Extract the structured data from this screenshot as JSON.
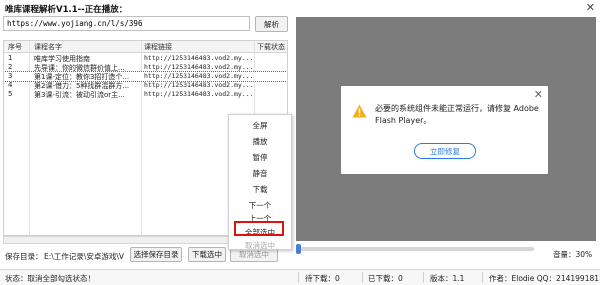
{
  "window": {
    "title": "唯库课程解析V1.1--正在播放：",
    "close_glyph": "✕"
  },
  "url_bar": {
    "value": "https://www.yojiang.cn/l/s/396",
    "parse_label": "解析"
  },
  "table": {
    "headers": [
      "序号",
      "课程名字",
      "课程链接",
      "下载状态"
    ],
    "rows": [
      {
        "index": "1",
        "name": "唯库学习使用指南",
        "link": "http://1253146483.vod2.my..."
      },
      {
        "index": "2",
        "name": "先导课：你的微信群价值上...",
        "link": "http://1253146483.vod2.my..."
      },
      {
        "index": "3",
        "name": "第1课-定位：教你3招打造个...",
        "link": "http://1253146483.vod2.my..."
      },
      {
        "index": "4",
        "name": "第2课-借力：5种找群混群方...",
        "link": "http://1253146483.vod2.my..."
      },
      {
        "index": "5",
        "name": "第3课-引流：被动引流or主...",
        "link": "http://1253146483.vod2.my..."
      }
    ]
  },
  "save": {
    "label": "保存目录：",
    "path": "E:\\工作记录\\安卓游戏\\V",
    "choose_label": "选择保存目录",
    "download_selected_label": "下载选中",
    "cancel_selected_label": "取消选中"
  },
  "player": {
    "flash_message": "必要的系统组件未能正常运行，请修复 Adobe Flash Player。",
    "repair_label": "立即修复",
    "progress": 0,
    "volume_label": "音量：30%",
    "volume": 0.3
  },
  "context_menu": {
    "items": [
      "全屏",
      "播放",
      "暂停",
      "静音",
      "下载",
      "下一个",
      "上一个",
      "全部选中",
      "取消选中"
    ],
    "highlighted": "全部选中",
    "disabled": [
      "取消选中"
    ]
  },
  "status_bar": {
    "status": "状态：取消全部勾选状态！",
    "pending": "待下载：0",
    "done": "已下载：0",
    "version": "版本：1.1",
    "author": "作者：Elodie QQ：214199181"
  },
  "colors": {
    "player_bg": "#7c7c7c",
    "accent_blue": "#2a7ae2",
    "highlight_red": "#dd1111",
    "warning_yellow": "#f2b01e"
  }
}
